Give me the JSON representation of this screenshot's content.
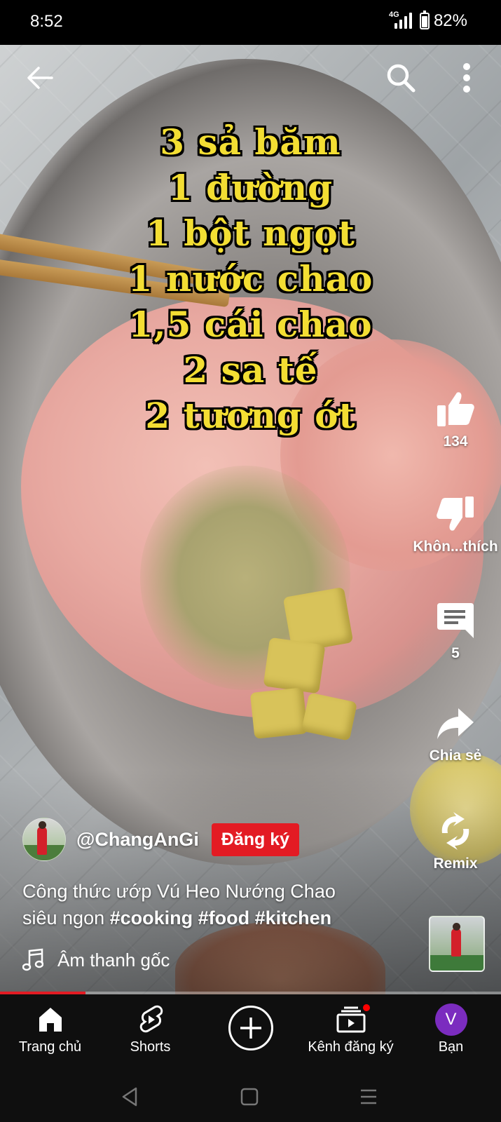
{
  "status_bar": {
    "time": "8:52",
    "network": "4G",
    "battery": "82%"
  },
  "video": {
    "recipe_lines": [
      "3 sả băm",
      "1 đường",
      "1 bột ngọt",
      "1 nước chao",
      "1,5 cái chao",
      "2 sa tế",
      "2 tương ớt"
    ],
    "progress_fraction": 0.17
  },
  "top_controls": {
    "back_icon": "back-arrow-icon",
    "search_icon": "search-icon",
    "more_icon": "more-vert-icon"
  },
  "actions": {
    "like_count": "134",
    "dislike_label": "Khôn...thích",
    "comment_count": "5",
    "share_label": "Chia sẻ",
    "remix_label": "Remix"
  },
  "channel": {
    "name": "@ChangAnGi",
    "subscribe_label": "Đăng ký"
  },
  "caption": {
    "text_line1": "Công thức ướp Vú Heo Nướng Chao",
    "text_line2_prefix": "siêu ngon ",
    "hashtags": "#cooking #food #kitchen"
  },
  "sound": {
    "label": "Âm thanh gốc"
  },
  "bottom_nav": {
    "items": [
      {
        "label": "Trang chủ",
        "icon": "home-icon"
      },
      {
        "label": "Shorts",
        "icon": "shorts-icon"
      },
      {
        "label": "",
        "icon": "create-icon"
      },
      {
        "label": "Kênh đăng ký",
        "icon": "subscriptions-icon"
      },
      {
        "label": "Bạn",
        "icon": "avatar-icon",
        "avatar_letter": "V"
      }
    ]
  },
  "colors": {
    "accent_red": "#e31b23",
    "recipe_text": "#f3de33",
    "avatar_purple": "#7b2cbf"
  }
}
